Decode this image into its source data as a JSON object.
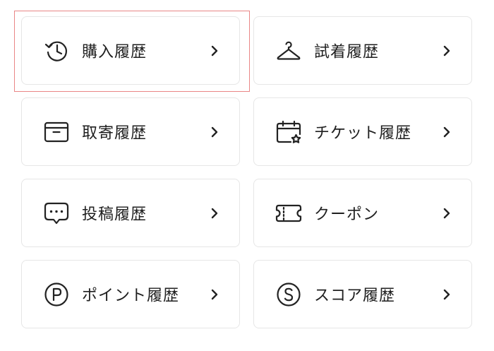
{
  "menu": {
    "items": [
      {
        "label": "購入履歴",
        "icon": "history-clock-icon"
      },
      {
        "label": "試着履歴",
        "icon": "hanger-icon"
      },
      {
        "label": "取寄履歴",
        "icon": "box-icon"
      },
      {
        "label": "チケット履歴",
        "icon": "calendar-star-icon"
      },
      {
        "label": "投稿履歴",
        "icon": "speech-bubble-icon"
      },
      {
        "label": "クーポン",
        "icon": "coupon-ticket-icon"
      },
      {
        "label": "ポイント履歴",
        "icon": "point-p-circle-icon"
      },
      {
        "label": "スコア履歴",
        "icon": "score-s-circle-icon"
      }
    ],
    "highlighted_item": "購入履歴",
    "colors": {
      "text": "#1f1f1f",
      "border": "#e6e6e6",
      "highlight": "#e98686",
      "icon": "#222222"
    }
  }
}
